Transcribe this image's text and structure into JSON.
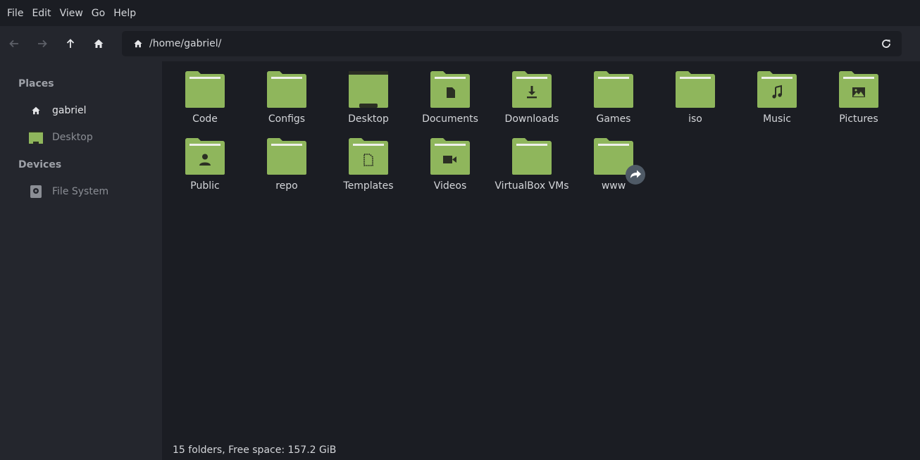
{
  "menu": [
    "File",
    "Edit",
    "View",
    "Go",
    "Help"
  ],
  "toolbar": {
    "path": "/home/gabriel/"
  },
  "sidebar": {
    "places_title": "Places",
    "places": [
      {
        "label": "gabriel",
        "icon": "home-icon"
      },
      {
        "label": "Desktop",
        "icon": "desktop-icon"
      }
    ],
    "devices_title": "Devices",
    "devices": [
      {
        "label": "File System",
        "icon": "drive-icon"
      }
    ]
  },
  "folders": [
    {
      "name": "Code",
      "icon": "folder-icon"
    },
    {
      "name": "Configs",
      "icon": "folder-icon"
    },
    {
      "name": "Desktop",
      "icon": "folder-desktop-icon"
    },
    {
      "name": "Documents",
      "icon": "folder-documents-icon"
    },
    {
      "name": "Downloads",
      "icon": "folder-download-icon"
    },
    {
      "name": "Games",
      "icon": "folder-icon"
    },
    {
      "name": "iso",
      "icon": "folder-icon"
    },
    {
      "name": "Music",
      "icon": "folder-music-icon"
    },
    {
      "name": "Pictures",
      "icon": "folder-pictures-icon"
    },
    {
      "name": "Public",
      "icon": "folder-public-icon"
    },
    {
      "name": "repo",
      "icon": "folder-icon"
    },
    {
      "name": "Templates",
      "icon": "folder-templates-icon"
    },
    {
      "name": "Videos",
      "icon": "folder-videos-icon"
    },
    {
      "name": "VirtualBox VMs",
      "icon": "folder-icon"
    },
    {
      "name": "www",
      "icon": "folder-link-icon"
    }
  ],
  "status": "15 folders, Free space: 157.2 GiB",
  "colors": {
    "folder": "#8fb65c",
    "folder_dark": "#2b2f23",
    "background": "#1b1d23",
    "sidebar": "#24262d"
  }
}
